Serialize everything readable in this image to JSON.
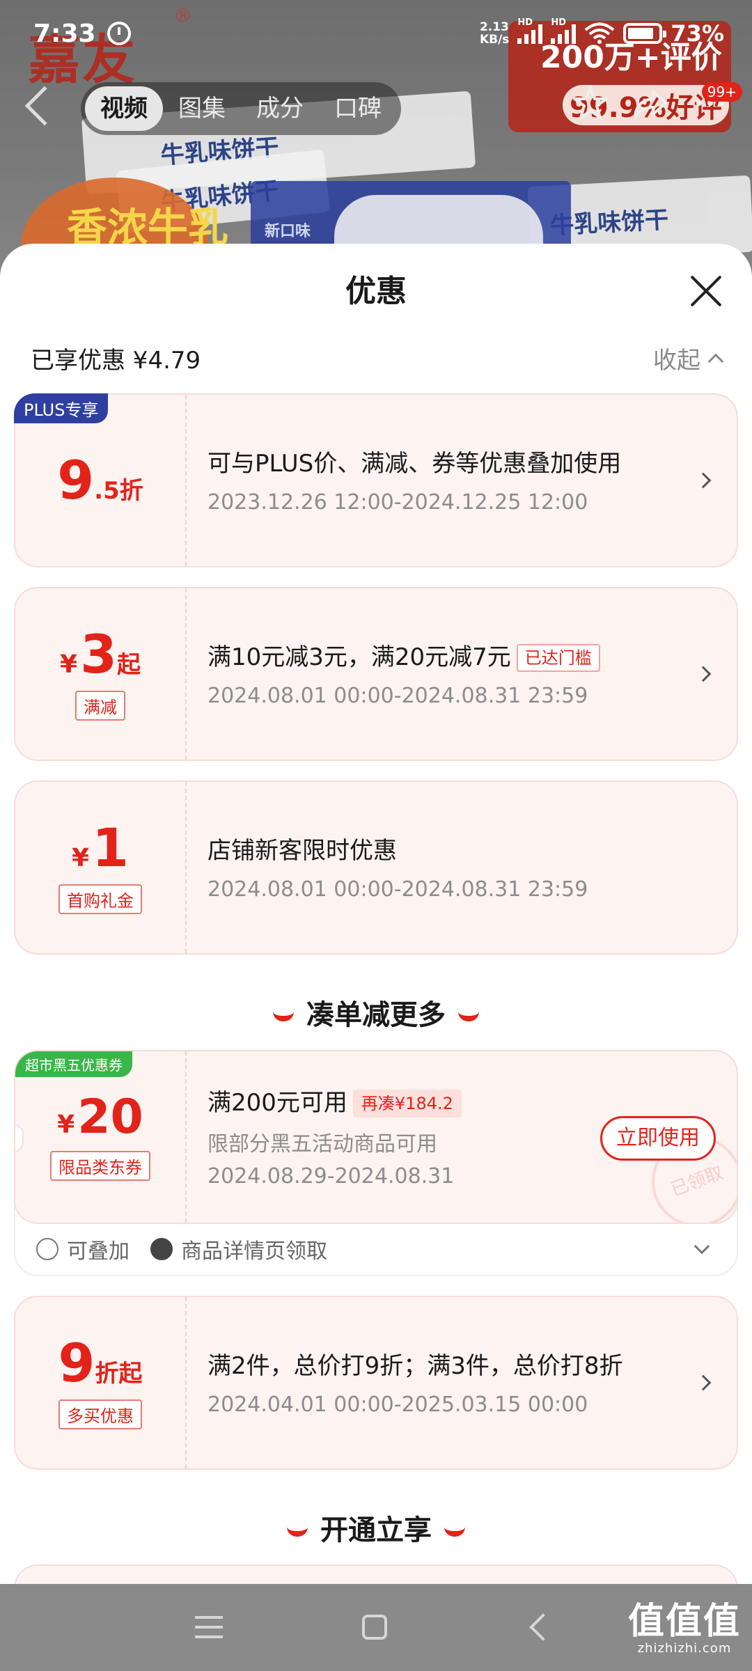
{
  "status_bar": {
    "time": "7:33",
    "speed_value": "2.13",
    "speed_unit": "KB/s",
    "hd_1": "HD",
    "hd_2": "HD",
    "battery_percent": "73%"
  },
  "background": {
    "brand_logo": "嘉友",
    "brand_mark": "®",
    "package_text": "牛乳味饼干",
    "new_flavor": "新口味",
    "promo_top": "200万+评价",
    "promo_rate": "99.9%好评",
    "round_text": "香浓牛乳"
  },
  "top_nav": {
    "tabs": [
      "视频",
      "图集",
      "成分",
      "口碑"
    ],
    "active_tab": 0,
    "cart_badge": "99+"
  },
  "sheet": {
    "title": "优惠",
    "enjoyed_label": "已享优惠 ¥4.79",
    "collapse_label": "收起"
  },
  "coupons": [
    {
      "corner_tag": "PLUS专享",
      "corner_color": "#2f3fa0",
      "amount_big": "9",
      "amount_small": ".5折",
      "desc": "可与PLUS价、满减、券等优惠叠加使用",
      "date": "2023.12.26 12:00-2024.12.25 12:00"
    },
    {
      "amount_prefix": "¥",
      "amount_big": "3",
      "amount_small": "起",
      "tag": "满减",
      "desc": "满10元减3元，满20元减7元",
      "desc_tag": "已达门槛",
      "date": "2024.08.01 00:00-2024.08.31 23:59"
    },
    {
      "amount_prefix": "¥",
      "amount_big": "1",
      "tag": "首购礼金",
      "desc": "店铺新客限时优惠",
      "date": "2024.08.01 00:00-2024.08.31 23:59"
    }
  ],
  "section_more": "凑单减更多",
  "black_five": {
    "corner_tag": "超市黑五优惠券",
    "corner_color": "#3ab54a",
    "amount_prefix": "¥",
    "amount_big": "20",
    "tag": "限品类东券",
    "desc": "满200元可用",
    "desc_tag": "再凑¥184.2",
    "sub": "限部分黑五活动商品可用",
    "date": "2024.08.29-2024.08.31",
    "use_button": "立即使用",
    "stamp": "已领取",
    "footer_stack": "可叠加",
    "footer_source": "商品详情页领取"
  },
  "multi_buy": {
    "amount_big": "9",
    "amount_small": "折起",
    "tag": "多买优惠",
    "desc": "满2件，总价打9折；满3件，总价打8折",
    "date": "2024.04.01 00:00-2025.03.15 00:00"
  },
  "section_open": "开通立享",
  "watermark": {
    "main": "值值值",
    "sub": "zhizhizhi.com"
  },
  "colors": {
    "accent_red": "#e2231a",
    "card_bg": "#fdf3f1",
    "plus_blue": "#2f3fa0",
    "black5_green": "#3ab54a"
  }
}
